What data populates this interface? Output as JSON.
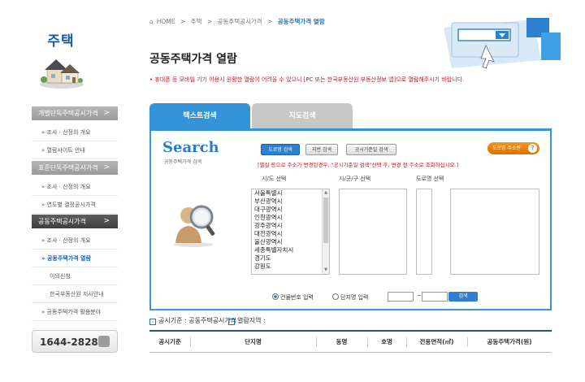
{
  "sidebar": {
    "title": "주택",
    "sections": [
      {
        "label": "개별단독주택공시가격",
        "chevron": ">"
      },
      {
        "label": "표준단독주택공시가격",
        "chevron": ">"
      },
      {
        "label": "공동주택공시가격",
        "chevron": ">"
      }
    ],
    "items1": [
      "조사 · 산정의 개요",
      "열람사이트 안내"
    ],
    "items2": [
      "조사 · 산정의 개요",
      "연도별 결정공시가격"
    ],
    "items3": [
      "조사 · 산정의 개요",
      "공동주택가격 열람",
      "이의신청",
      "한국부동산원 지사안내",
      "공동주택가격 활용분야"
    ],
    "bullet": "»",
    "phone": "1644-2828"
  },
  "breadcrumb": {
    "home": "HOME",
    "sep": ">",
    "items": [
      "주택",
      "공동주택공시가격",
      "공동주택가격 열람"
    ]
  },
  "page": {
    "title": "공동주택가격 열람",
    "notice": "• 휴대폰 등 모바일 기기 이용시 원활한 열람이 어려울 수 있으니 [PC 또는 한국부동산원 부동산정보 앱]으로 열람해주시기 바랍니다."
  },
  "tabs": [
    {
      "label": "텍스트검색"
    },
    {
      "label": "지도검색"
    }
  ],
  "search": {
    "logo": "Search",
    "logo_sub": "공동주택가격 검색",
    "btn_road": "도로명 검색",
    "btn_lot": "지번 검색",
    "btn_base": "공시기준일 검색",
    "btn_road_addr": "도로명 주소란",
    "q_mark": "?",
    "warning": "[멸실 등으로 주소가 변경된경우, \"공시기준일 검색\"선택 후, 변경 전 주소로 조회하십시오.]",
    "col_sido": "시/도 선택",
    "col_sigungu": "시/군/구 선택",
    "col_road": "도로명 선택",
    "sido_options": [
      "서울특별시",
      "부산광역시",
      "대구광역시",
      "인천광역시",
      "광주광역시",
      "대전광역시",
      "울산광역시",
      "세종특별자치시",
      "경기도",
      "강원도"
    ],
    "radio_building": "건물번호 입력",
    "radio_complex": "단지명 입력",
    "tilde": "~",
    "search_btn": "검색"
  },
  "tags": {
    "criteria": "공시기준 : 공동주택공시가격",
    "area": "열람지역 :"
  },
  "table": {
    "headers": [
      "공시기준",
      "단지명",
      "동명",
      "호명",
      "전용면적(㎡)",
      "공동주택가격(원)"
    ]
  },
  "colors": {
    "accent": "#3394da",
    "red": "#c8181e",
    "orange": "#f39420",
    "dark_blue": "#2a4f85"
  }
}
